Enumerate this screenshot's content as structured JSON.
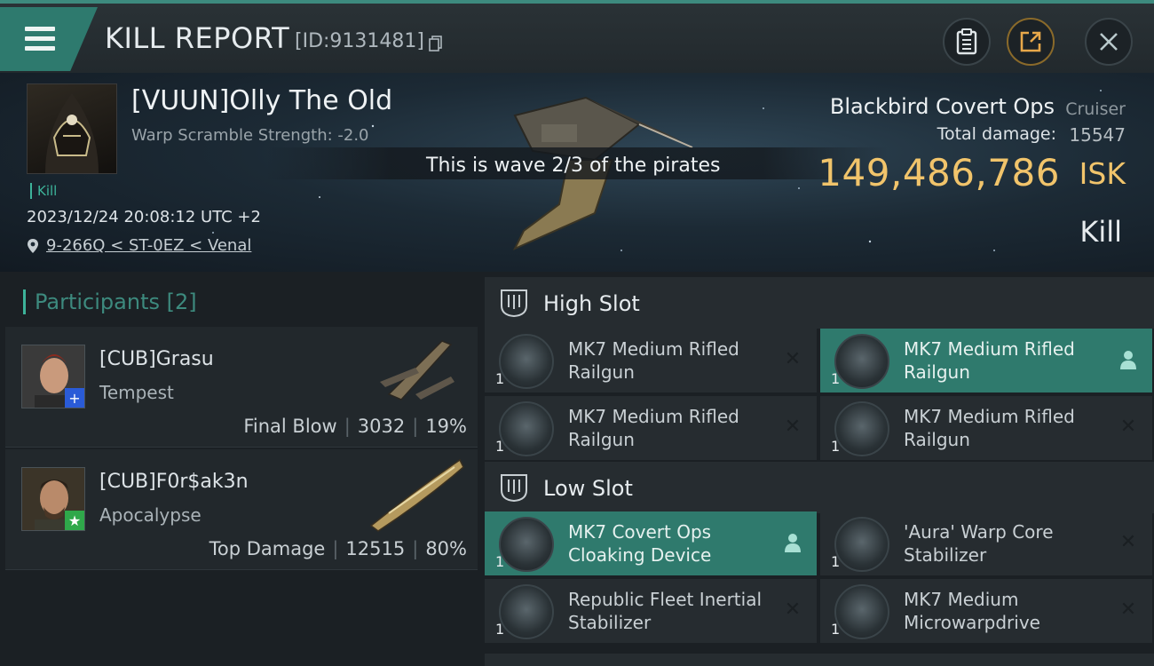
{
  "header": {
    "title": "KILL REPORT",
    "report_id": "[ID:9131481]"
  },
  "victim": {
    "name": "[VUUN]Olly The Old",
    "warp_scramble": "Warp Scramble Strength: -2.0",
    "tag": "Kill",
    "datetime": "2023/12/24 20:08:12 UTC +2",
    "location": "9-266Q < ST-0EZ < Venal",
    "wave_text": "This is wave 2/3 of the pirates",
    "ship_name": "Blackbird Covert Ops",
    "ship_class": "Cruiser",
    "total_damage_label": "Total damage:",
    "total_damage": "15547",
    "isk_value": "149,486,786",
    "isk_unit": "ISK",
    "result": "Kill"
  },
  "participants": {
    "header": "Participants",
    "count": "[2]",
    "rows": [
      {
        "name": "[CUB]Grasu",
        "ship": "Tempest",
        "role": "Final Blow",
        "damage": "3032",
        "percent": "19%",
        "badge": "+",
        "badge_color": "#2a5bd7"
      },
      {
        "name": "[CUB]F0r$ak3n",
        "ship": "Apocalypse",
        "role": "Top Damage",
        "damage": "12515",
        "percent": "80%",
        "badge": "★",
        "badge_color": "#2fa84a"
      }
    ]
  },
  "fitting": {
    "high_slot_label": "High Slot",
    "low_slot_label": "Low Slot",
    "high": [
      {
        "name": "MK7 Medium Rifled Railgun",
        "qty": "1",
        "action": "x",
        "selected": false
      },
      {
        "name": "MK7 Medium Rifled Railgun",
        "qty": "1",
        "action": "person",
        "selected": true
      },
      {
        "name": "MK7 Medium Rifled Railgun",
        "qty": "1",
        "action": "x",
        "selected": false
      },
      {
        "name": "MK7 Medium Rifled Railgun",
        "qty": "1",
        "action": "x",
        "selected": false
      }
    ],
    "low": [
      {
        "name": "MK7 Covert Ops Cloaking Device",
        "qty": "1",
        "action": "person",
        "selected": true
      },
      {
        "name": "'Aura' Warp Core Stabilizer",
        "qty": "1",
        "action": "x",
        "selected": false
      },
      {
        "name": "Republic Fleet Inertial Stabilizer",
        "qty": "1",
        "action": "x",
        "selected": false
      },
      {
        "name": "MK7 Medium Microwarpdrive",
        "qty": "1",
        "action": "x",
        "selected": false
      }
    ]
  },
  "colors": {
    "accent": "#2f7a6d",
    "isk": "#f1c46b",
    "kill_tag": "#3db39a"
  }
}
